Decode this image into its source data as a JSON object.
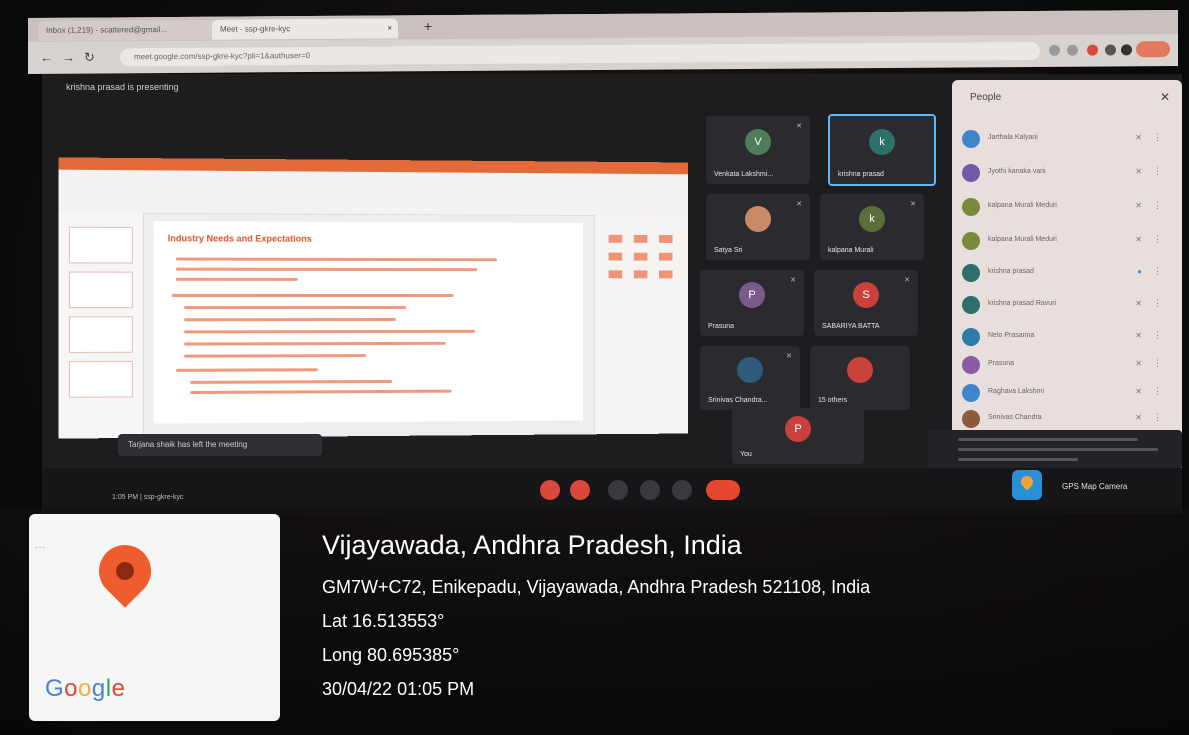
{
  "browser": {
    "tabs": [
      {
        "label": "Inbox (1,219) - scattered@gmail..."
      },
      {
        "label": "Meet - ssp-gkre-kyc"
      }
    ],
    "url": "meet.google.com/ssp-gkre-kyc?pli=1&authuser=0",
    "new_tab_icon": "plus-icon"
  },
  "meet": {
    "presenting_banner": "krishna prasad is presenting",
    "slide": {
      "title": "Industry Needs and Expectations"
    },
    "tiles": [
      {
        "initial": "V",
        "name": "Venkata Lakshmi...",
        "color": "#4f7d5a"
      },
      {
        "initial": "k",
        "name": "krishna prasad",
        "color": "#2f6f6b",
        "selected": true
      },
      {
        "initial": "",
        "name": "Satya Sri",
        "color": "#c98a6a"
      },
      {
        "initial": "k",
        "name": "kalpana Murali",
        "color": "#5c6e3a"
      },
      {
        "initial": "P",
        "name": "Prasuna",
        "color": "#7a5a8a"
      },
      {
        "initial": "S",
        "name": "SABARIYA BATTA",
        "color": "#c9413b"
      },
      {
        "initial": "",
        "name": "Srinivas Chandra...",
        "color": "#2f5a7a"
      },
      {
        "initial": "",
        "name": "15 others",
        "color": "#c9413b"
      },
      {
        "initial": "P",
        "name": "You",
        "color": "#c9413b"
      }
    ],
    "toast": "Tarjana shaik has left the meeting",
    "time": "1:05 PM | ssp-gkre-kyc"
  },
  "people_panel": {
    "title": "People",
    "entries": [
      {
        "name": "Jarthala Kalyani",
        "color": "#3f85c9"
      },
      {
        "name": "Jyothi kanaka vani",
        "color": "#6f5aa6"
      },
      {
        "name": "kalpana Murali Meduri",
        "color": "#7a8a3a"
      },
      {
        "name": "kalpana Murali Meduri",
        "color": "#7a8a3a"
      },
      {
        "name": "krishna prasad",
        "color": "#2f6f6b"
      },
      {
        "name": "krishna prasad Ravuri",
        "color": "#2f6f6b"
      },
      {
        "name": "Nelo Prasanna",
        "color": "#2f7aa6"
      },
      {
        "name": "Prasuna",
        "color": "#8a5aa6"
      },
      {
        "name": "Raghava Lakshmi",
        "color": "#3f85c9"
      },
      {
        "name": "Srinivas Chandra",
        "color": "#8a5a3a"
      }
    ]
  },
  "gps_app": {
    "label": "GPS Map Camera"
  },
  "location": {
    "title": "Vijayawada, Andhra Pradesh, India",
    "address": "GM7W+C72, Enikepadu, Vijayawada, Andhra Pradesh 521108, India",
    "lat": "Lat 16.513553°",
    "long": "Long 80.695385°",
    "datetime": "30/04/22 01:05 PM"
  },
  "map_card": {
    "brand_parts": [
      "G",
      "o",
      "o",
      "g",
      "l",
      "e"
    ]
  }
}
